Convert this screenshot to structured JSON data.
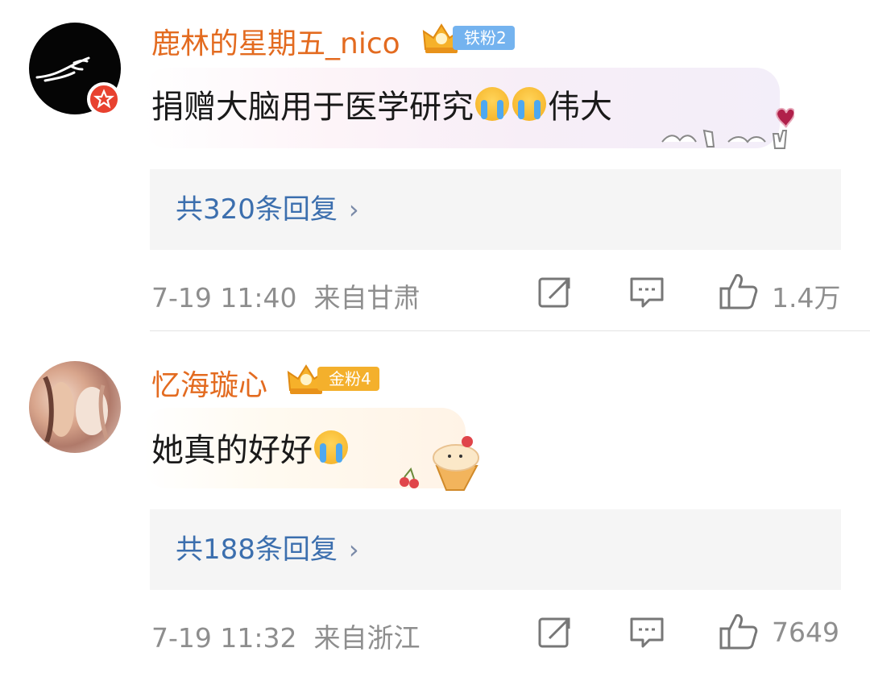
{
  "comments": [
    {
      "username": "鹿林的星期五_nico",
      "fan_badge": "铁粉2",
      "text": "捐赠大脑用于医学研究",
      "text_suffix": "伟大",
      "replies_label": "共320条回复",
      "time": "7-19 11:40",
      "location": "来自甘肃",
      "likes": "1.4万"
    },
    {
      "username": "忆海璇心",
      "fan_badge": "金粉4",
      "text": "她真的好好",
      "text_suffix": "",
      "replies_label": "共188条回复",
      "time": "7-19 11:32",
      "location": "来自浙江",
      "likes": "7649"
    }
  ],
  "icons": {
    "share": "share-icon",
    "comment": "comment-icon",
    "like": "thumbs-up-icon",
    "chevron": "chevron-right-icon",
    "emoji": "crying-emoji-icon"
  },
  "colors": {
    "username": "#e36b20",
    "replies_link": "#3c6fae",
    "meta": "#8e8e8e",
    "iron_fan": "#74b3ef",
    "gold_fan": "#f4b02c"
  }
}
